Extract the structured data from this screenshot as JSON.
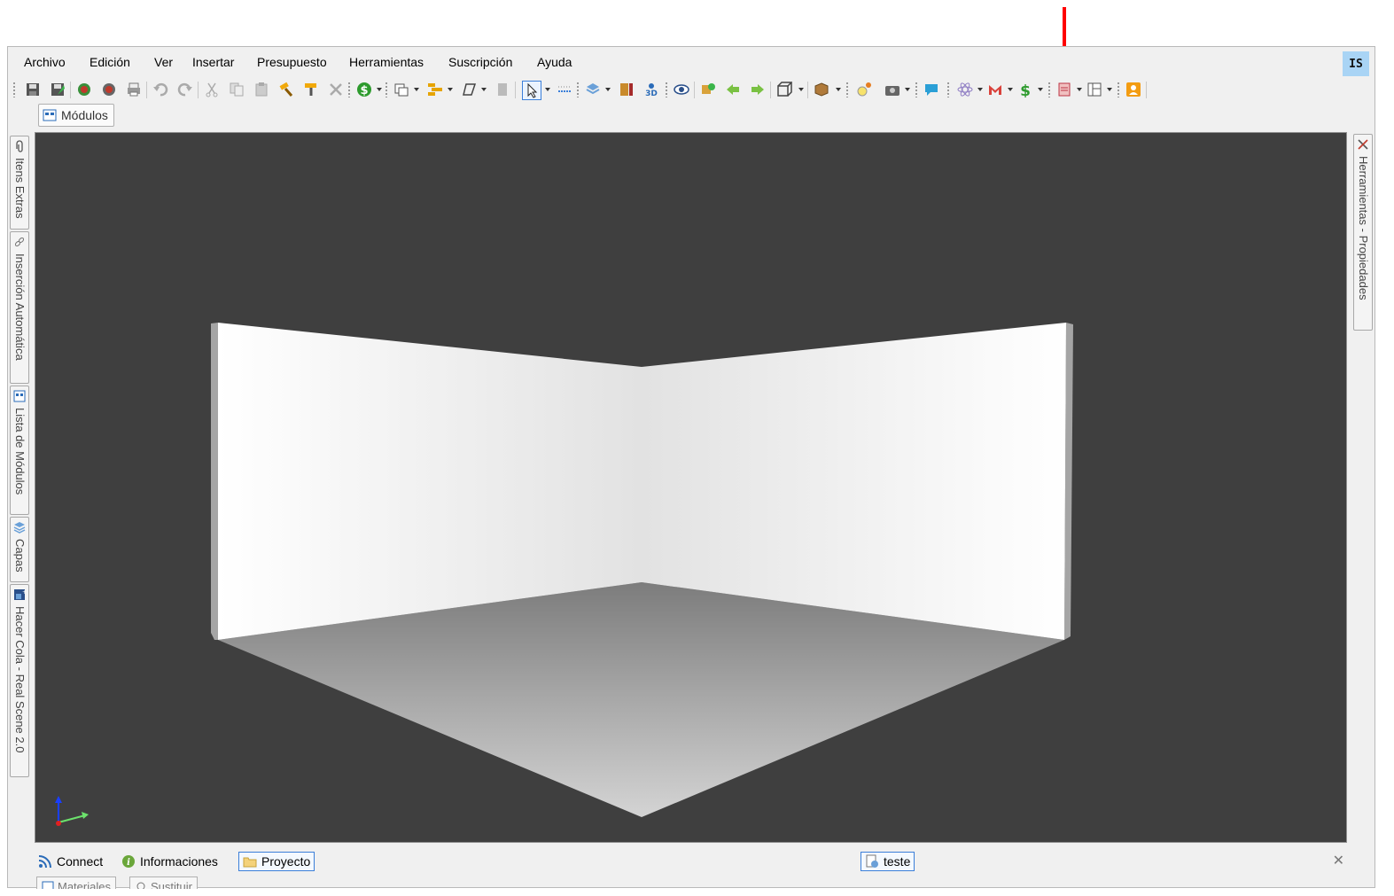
{
  "menu": [
    "Archivo",
    "Edición",
    "Ver",
    "Insertar",
    "Presupuesto",
    "Herramientas",
    "Suscripción",
    "Ayuda"
  ],
  "user_badge": "IS",
  "document_tab": "Módulos",
  "left_dock_tabs": [
    "Itens Extras",
    "Inserción Automática",
    "Lista de Módulos",
    "Capas",
    "Hacer Cola - Real Scene 2.0"
  ],
  "right_dock_tabs": [
    "Herramientas - Propiedades"
  ],
  "status_items": [
    "Connect",
    "Informaciones",
    "Proyecto"
  ],
  "active_status_item": "Proyecto",
  "project_name": "teste",
  "bottom_tabs": [
    "Materiales",
    "Sustituir"
  ],
  "colors": {
    "viewport_background": "#3f3f3f",
    "annotation_arrow": "#ff0000",
    "active_tab_border": "#3b7fd9",
    "user_badge_bg": "#a9d4f5"
  },
  "toolbar_icons": [
    "save-icon",
    "save-as-icon",
    "pieces-icon",
    "modules-icon",
    "print-icon",
    "undo-icon",
    "redo-icon",
    "cut-icon",
    "copy-icon",
    "paste-icon",
    "hammer-icon",
    "paint-roller-icon",
    "delete-icon",
    "dollar-coin-icon",
    "view-icon",
    "layers-sort-icon",
    "shape-icon",
    "panel-icon",
    "select-pointer-icon",
    "ruler-icon",
    "layers-icon",
    "cabinet-icon",
    "3d-icon",
    "eye-icon",
    "module-add-icon",
    "arrow-left-icon",
    "arrow-right-icon",
    "box-view-icon",
    "package-icon",
    "light-bulb-icon",
    "camera-icon",
    "chat-icon",
    "atom-icon",
    "mail-icon",
    "price-icon",
    "report-icon",
    "layout-icon",
    "user-icon"
  ]
}
